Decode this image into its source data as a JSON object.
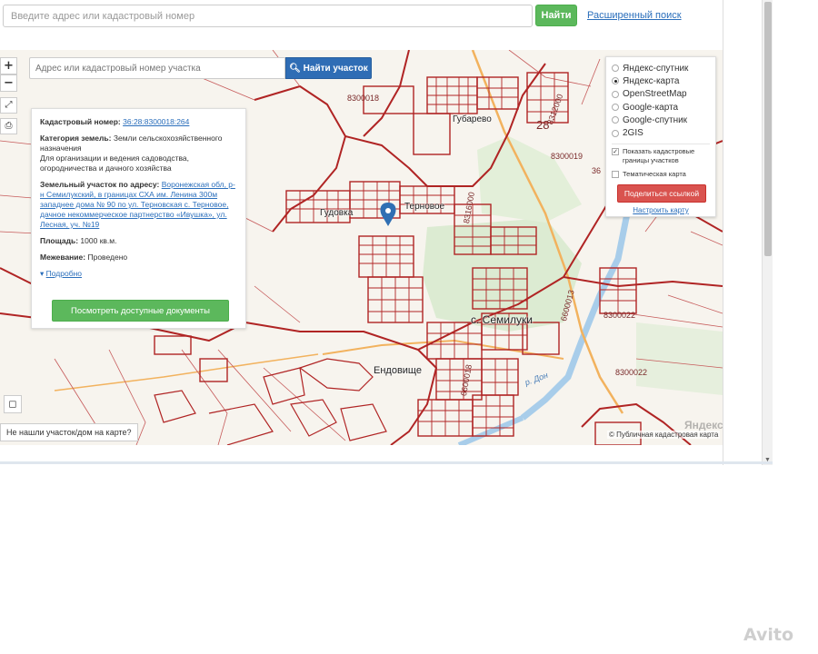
{
  "top_search": {
    "placeholder": "Введите адрес или кадастровый номер",
    "find_label": "Найти",
    "advanced_link": "Расширенный поиск"
  },
  "map_search": {
    "placeholder": "Адрес или кадастровый номер участка",
    "find_label": "Найти участок",
    "find_icon": "search-icon"
  },
  "map_controls": {
    "zoom_in": "+",
    "zoom_out": "−",
    "fullscreen_icon": "expand-icon",
    "print_icon": "print-icon",
    "corner_icon": "square-icon"
  },
  "info": {
    "cadastral_label": "Кадастровый номер:",
    "cadastral_value": "36:28:8300018:264",
    "category_label": "Категория земель:",
    "category_value": "Земли сельскохозяйственного назначения",
    "usage_value": "Для организации и ведения садоводства, огородничества и дачного хозяйства",
    "address_label": "Земельный участок по адресу:",
    "address_value": "Воронежская обл, р-н Семилукский, в границах СХА им. Ленина 300м западнее дома № 90 по ул. Терновская с. Терновое, дачное некоммерческое партнерство «Ивушка», ул. Лесная, уч. №19",
    "area_label": "Площадь:",
    "area_value": "1000 кв.м.",
    "survey_label": "Межевание:",
    "survey_value": "Проведено",
    "more_label": "Подробно",
    "docs_button": "Посмотреть доступные документы"
  },
  "layers": {
    "options": [
      {
        "label": "Яндекс-спутник",
        "selected": false
      },
      {
        "label": "Яндекс-карта",
        "selected": true
      },
      {
        "label": "OpenStreetMap",
        "selected": false
      },
      {
        "label": "Google-карта",
        "selected": false
      },
      {
        "label": "Google-спутник",
        "selected": false
      },
      {
        "label": "2GIS",
        "selected": false
      }
    ],
    "show_boundaries": {
      "label": "Показать кадастровые границы участков",
      "checked": true
    },
    "thematic_map": {
      "label": "Тематическая карта",
      "checked": false
    },
    "share_button": "Поделиться ссылкой",
    "setup_link": "Настроить карту"
  },
  "map_labels": {
    "q1": "8300018",
    "q2": "8300019",
    "q3": "8300022",
    "q4": "8300022",
    "q5": "8316000",
    "q6": "6600013",
    "q7": "6600018",
    "q8": "8312000",
    "n28": "28",
    "n36a": "36",
    "n36b": "36",
    "t1": "Гудовка",
    "t2": "Терновое",
    "t3": "Губарево",
    "t4": "с. Семилуки",
    "t5": "Ендовище",
    "river": "р. Дон"
  },
  "not_found": "Не нашли участок/дом на карте?",
  "copyright": "© Публичная кадастровая карта",
  "watermark_yandex": "Яндекс",
  "watermark_avito": "Avito",
  "colors": {
    "parcel_border": "#b02424",
    "forest": "#dcebd2",
    "road": "#f2b25e",
    "river": "#a8cdea"
  }
}
